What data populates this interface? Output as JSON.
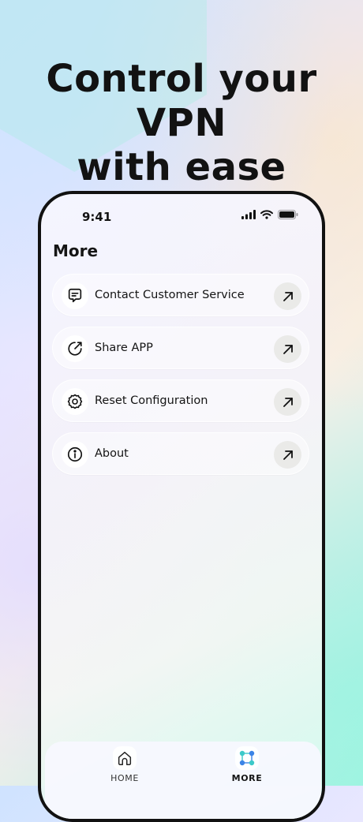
{
  "headline": {
    "line1": "Control your VPN",
    "line2": "with ease"
  },
  "status_bar": {
    "time": "9:41",
    "icons": [
      "cellular-signal-icon",
      "wifi-icon",
      "battery-icon"
    ]
  },
  "page": {
    "title": "More"
  },
  "menu": {
    "items": [
      {
        "label": "Contact Customer Service",
        "icon": "chat-message-icon",
        "action_icon": "arrow-up-right-icon"
      },
      {
        "label": "Share APP",
        "icon": "share-arc-icon",
        "action_icon": "arrow-up-right-icon"
      },
      {
        "label": "Reset Configuration",
        "icon": "gear-icon",
        "action_icon": "arrow-up-right-icon"
      },
      {
        "label": "About",
        "icon": "info-icon",
        "action_icon": "arrow-up-right-icon"
      }
    ]
  },
  "tab_bar": {
    "tabs": [
      {
        "label": "HOME",
        "icon": "home-icon",
        "active": false
      },
      {
        "label": "MORE",
        "icon": "grid-nodes-icon",
        "active": true
      }
    ]
  },
  "colors": {
    "text_primary": "#121212",
    "accent_teal": "#3cc9c9",
    "accent_blue": "#3b84e6"
  }
}
